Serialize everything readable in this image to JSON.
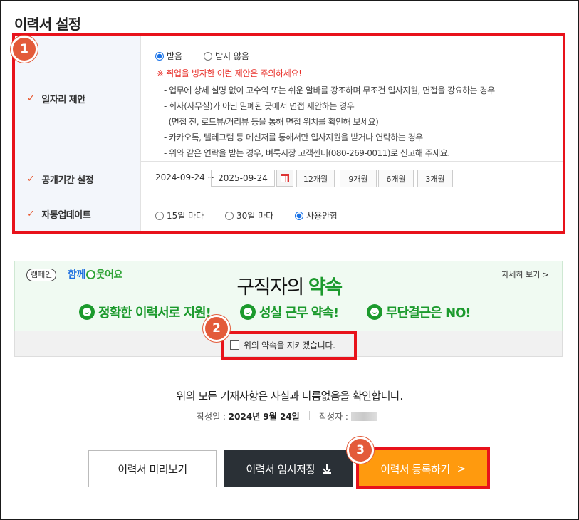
{
  "page": {
    "section_title": "이력서 설정"
  },
  "settings": {
    "job_offer": {
      "label": "일자리 제안",
      "option_receive": "받음",
      "option_decline": "받지 않음",
      "selected": "받음",
      "warning": "※ 취업을 빙자한 이런 제안은 주의하세요!",
      "bullets": [
        "- 업무에 상세 설명 없이 고수익 또는 쉬운 알바를 강조하며 무조건 입사지원, 면접을 강요하는 경우",
        "- 회사(사무실)가 아닌 밀폐된 곳에서 면접 제안하는 경우",
        "  (면접 전, 로드뷰/거리뷰 등을 통해 면접 위치를 확인해 보세요)",
        "- 카카오톡, 텔레그램 등 메신저를 통해서만 입사지원을 받거나 연락하는 경우",
        "- 위와 같은 연락을 받는 경우, 벼룩시장 고객센터(080-269-0011)로 신고해 주세요."
      ]
    },
    "period": {
      "label": "공개기간 설정",
      "start": "2024-09-24 ~",
      "end": "2025-09-24",
      "buttons": [
        "12개월",
        "9개월",
        "6개월",
        "3개월"
      ]
    },
    "auto_update": {
      "label": "자동업데이트",
      "options": [
        "15일 마다",
        "30일 마다",
        "사용안함"
      ],
      "selected": "사용안함"
    }
  },
  "campaign": {
    "tag": "캠페인",
    "brand_part1": "함께",
    "brand_part2": "웃어요",
    "more": "자세히 보기 >",
    "title_prefix": "구직자의 ",
    "title_highlight": "약속",
    "slogans": [
      "정확한 이력서로 지원!",
      "성실 근무 약속!",
      "무단결근은 NO!"
    ],
    "promise_label": "위의 약속을 지키겠습니다."
  },
  "confirm": {
    "text": "위의 모든 기재사항은 사실과 다름없음을 확인합니다.",
    "date_label": "작성일 : ",
    "date_value": "2024년 9월 24일",
    "author_label": "작성자 :"
  },
  "actions": {
    "preview": "이력서 미리보기",
    "temp_save": "이력서 임시저장",
    "submit": "이력서 등록하기"
  },
  "annotations": {
    "badge1": "1",
    "badge2": "2",
    "badge3": "3"
  },
  "colors": {
    "highlight": "#e8121b",
    "badge": "#e35b3a",
    "submit": "#ff9a0e",
    "campaign_green": "#1c9a2d",
    "radio_selected": "#1a73e8"
  }
}
